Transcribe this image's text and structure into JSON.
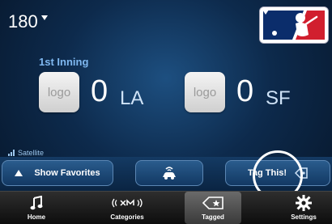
{
  "channel": {
    "number": "180"
  },
  "game": {
    "inning": "1st Inning",
    "away": {
      "logo_text": "logo",
      "score": "0",
      "abbr": "LA"
    },
    "home": {
      "logo_text": "logo",
      "score": "0",
      "abbr": "SF"
    }
  },
  "status": {
    "signal": "Satellite"
  },
  "actions": {
    "show_favorites": "Show Favorites",
    "tag_this": "Tag This!"
  },
  "tabs": [
    {
      "label": "Home",
      "icon": "music-note-icon"
    },
    {
      "label": "Categories",
      "icon": "sxm-logo-icon"
    },
    {
      "label": "Tagged",
      "icon": "tag-star-icon",
      "active": true
    },
    {
      "label": "Settings",
      "icon": "gear-icon"
    }
  ],
  "colors": {
    "background": "#0d2a4c",
    "inning_text": "#7fb8f0",
    "mlb_red": "#d11f2e",
    "mlb_blue": "#0b2d6b"
  }
}
